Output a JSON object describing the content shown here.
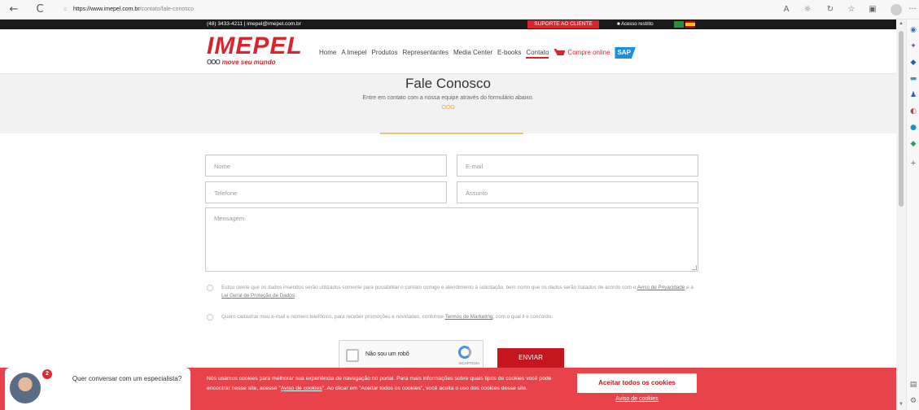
{
  "browser": {
    "url_host": "https://www.imepel.com.br",
    "url_path": "/contato/fale-conosco",
    "back_icon": "←",
    "reload_icon": "C",
    "more_icon": "···"
  },
  "topbar": {
    "contact": "(48) 3433-4211 | imepel@imepel.com.br",
    "support": "SUPORTE AO CLIENTE",
    "restricted": "Acesso restrito"
  },
  "logo": {
    "brand": "IMEPEL",
    "tagline": "move seu mundo",
    "tagline_mark": "OOO"
  },
  "menu": {
    "items": [
      "Home",
      "A Imepel",
      "Produtos",
      "Representantes",
      "Media Center",
      "E-books",
      "Contato"
    ],
    "shop": "Compre online",
    "sap": "SAP"
  },
  "hero": {
    "title": "Fale Conosco",
    "subtitle": "Entre em contato com a nossa equipe através do formulário abaixo.",
    "dots": "OOO"
  },
  "form": {
    "name_placeholder": "Nome",
    "email_placeholder": "E-mail",
    "phone_placeholder": "Telefone",
    "subject_placeholder": "Assunto",
    "message_placeholder": "Mensagem",
    "consent1_a": "Estou ciente que os dados inseridos serão utilizados somente para possibilitar o contato comigo e atendimento à solicitação, bem como que os dados serão tratados de acordo com o ",
    "consent1_link1": "Aviso de Privacidade",
    "consent1_b": " e a ",
    "consent1_link2": "Lei Geral de Proteção de Dados",
    "consent1_c": ".",
    "consent2_a": "Quero cadastrar meu e-mail e número telefônico, para receber promoções e novidades, conforme ",
    "consent2_link": "Termos de Marketing",
    "consent2_b": ", com o qual li e concordo.",
    "recaptcha_label": "Não sou um robô",
    "recaptcha_brand": "reCAPTCHA",
    "send": "ENVIAR"
  },
  "chat": {
    "badge": "2",
    "text": "Quer conversar com um especialista?"
  },
  "cookie": {
    "text_a": "Nós usamos cookies para melhorar sua experiência de navegação no portal. Para mais informações sobre quais tipos de cookies você pode encontrar nesse site, acesse \"",
    "text_link": "Aviso de cookies",
    "text_b": "\". Ao clicar em \"Aceitar todos os cookies\", você aceita o uso dos cookies desse site.",
    "accept": "Aceitar todos os cookies",
    "notice": "Aviso de cookies"
  },
  "colors": {
    "brand_red": "#d9242b",
    "cookie_bg": "#e8424a",
    "send_bg": "#c4161c",
    "dots": "#f0a830"
  }
}
